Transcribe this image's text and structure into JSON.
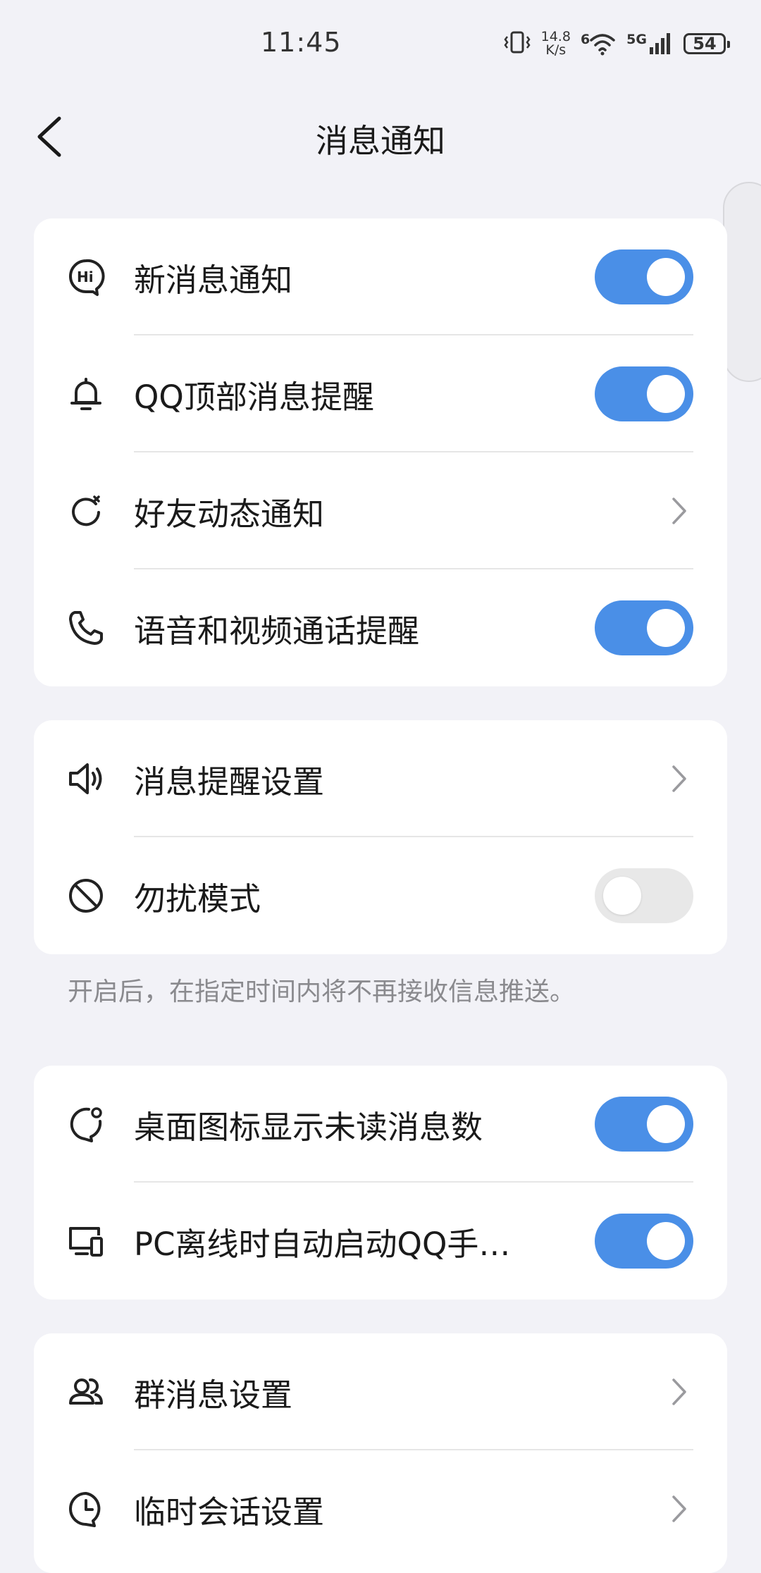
{
  "status_bar": {
    "time": "11:45",
    "net_speed_value": "14.8",
    "net_speed_unit": "K/s",
    "wifi_badge": "6",
    "signal_label": "5G",
    "battery": "54"
  },
  "header": {
    "title": "消息通知"
  },
  "groups": [
    {
      "items": [
        {
          "label": "新消息通知",
          "icon": "hi-bubble-icon",
          "control": "toggle",
          "on": true
        },
        {
          "label": "QQ顶部消息提醒",
          "icon": "bell-icon",
          "control": "toggle",
          "on": true
        },
        {
          "label": "好友动态通知",
          "icon": "refresh-star-icon",
          "control": "chevron"
        },
        {
          "label": "语音和视频通话提醒",
          "icon": "phone-icon",
          "control": "toggle",
          "on": true
        }
      ]
    },
    {
      "items": [
        {
          "label": "消息提醒设置",
          "icon": "speaker-icon",
          "control": "chevron"
        },
        {
          "label": "勿扰模式",
          "icon": "no-entry-icon",
          "control": "toggle",
          "on": false
        }
      ],
      "footer_hint": "开启后，在指定时间内将不再接收信息推送。"
    },
    {
      "items": [
        {
          "label": "桌面图标显示未读消息数",
          "icon": "badge-bubble-icon",
          "control": "toggle",
          "on": true
        },
        {
          "label": "PC离线时自动启动QQ手…",
          "icon": "devices-icon",
          "control": "toggle",
          "on": true
        }
      ]
    },
    {
      "items": [
        {
          "label": "群消息设置",
          "icon": "group-icon",
          "control": "chevron"
        },
        {
          "label": "临时会话设置",
          "icon": "clock-bubble-icon",
          "control": "chevron"
        }
      ]
    }
  ],
  "colors": {
    "toggle_on": "#4a8fe7",
    "toggle_off": "#e8e8e8",
    "background": "#f2f2f7",
    "card": "#ffffff"
  }
}
